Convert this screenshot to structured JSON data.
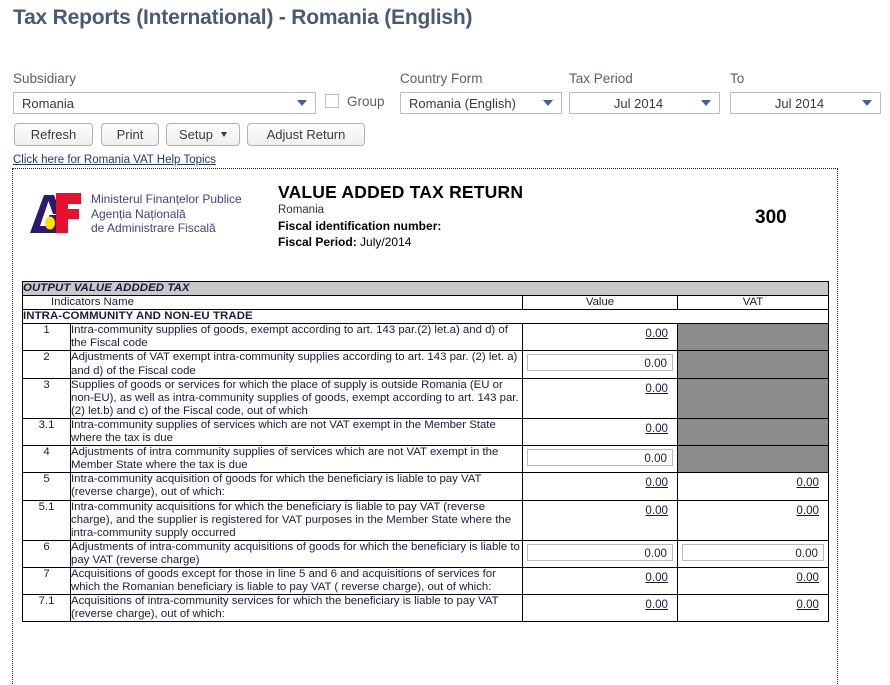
{
  "page_title": "Tax Reports (International) - Romania (English)",
  "filters": {
    "subsidiary": {
      "label": "Subsidiary",
      "value": "Romania"
    },
    "group": {
      "label": "Group",
      "checked": false
    },
    "country_form": {
      "label": "Country Form",
      "value": "Romania (English)"
    },
    "tax_period": {
      "label": "Tax Period",
      "value": "Jul 2014"
    },
    "to": {
      "label": "To",
      "value": "Jul 2014"
    }
  },
  "buttons": {
    "refresh": "Refresh",
    "print": "Print",
    "setup": "Setup",
    "adjust_return": "Adjust Return"
  },
  "help_link": "Click here for Romania VAT Help Topics",
  "report": {
    "agency_lines": "Ministerul Finanțelor Publice\nAgenția Națională\nde Administrare Fiscală",
    "agency_line1": "Ministerul Finanțelor Publice",
    "agency_line2": "Agenția Națională",
    "agency_line3": "de Administrare Fiscală",
    "title": "VALUE ADDED TAX RETURN",
    "country": "Romania",
    "fiscal_id_label": "Fiscal identification number:",
    "fiscal_period_label": "Fiscal Period:",
    "fiscal_period_value": "July/2014",
    "form_number": "300",
    "section_title": "OUTPUT VALUE ADDDED TAX",
    "columns": {
      "indicators": "Indicators Name",
      "value": "Value",
      "vat": "VAT"
    },
    "group_title": "INTRA-COMMUNITY AND NON-EU TRADE",
    "rows": [
      {
        "no": "1",
        "desc": "Intra-community supplies of goods, exempt according to art. 143 par.(2) let.a) and d) of the Fiscal code",
        "value": "0.00",
        "value_type": "link",
        "vat": "",
        "vat_type": "gray"
      },
      {
        "no": "2",
        "desc": "Adjustments of VAT exempt intra-community supplies according to art. 143 par. (2) let. a) and d) of the Fiscal code",
        "value": "0.00",
        "value_type": "input",
        "vat": "",
        "vat_type": "gray"
      },
      {
        "no": "3",
        "desc": "Supplies of goods or services for which the place of supply is outside Romania (EU or non-EU), as well as intra-community supplies of goods, exempt according to art. 143 par.(2) let.b) and c) of the Fiscal code, out of which",
        "value": "0.00",
        "value_type": "link",
        "vat": "",
        "vat_type": "gray"
      },
      {
        "no": "3.1",
        "desc": "Intra-community supplies of services which are not VAT exempt in the Member State where the tax is due",
        "value": "0.00",
        "value_type": "link",
        "vat": "",
        "vat_type": "gray"
      },
      {
        "no": "4",
        "desc": "Adjustments of intra community supplies of services which are not VAT exempt in the Member State where the tax is due",
        "value": "0.00",
        "value_type": "input",
        "vat": "",
        "vat_type": "gray"
      },
      {
        "no": "5",
        "desc": "Intra-community acquisition of goods for which the beneficiary is liable to pay VAT (reverse charge), out of which:",
        "value": "0.00",
        "value_type": "link",
        "vat": "0.00",
        "vat_type": "link"
      },
      {
        "no": "5.1",
        "desc": "Intra-community acquisitions for which the beneficiary is liable to pay VAT (reverse charge), and the supplier is registered for VAT purposes in the Member State where the intra-community supply occurred",
        "value": "0.00",
        "value_type": "link",
        "vat": "0.00",
        "vat_type": "link"
      },
      {
        "no": "6",
        "desc": "Adjustments of intra-community acquisitions of goods for which the beneficiary is liable to pay VAT (reverse charge)",
        "value": "0.00",
        "value_type": "input",
        "vat": "0.00",
        "vat_type": "input"
      },
      {
        "no": "7",
        "desc": "Acquisitions of goods except for those in line 5 and 6 and acquisitions of services for which the Romanian beneficiary is liable to pay VAT ( reverse charge), out of which:",
        "value": "0.00",
        "value_type": "link",
        "vat": "0.00",
        "vat_type": "link"
      },
      {
        "no": "7.1",
        "desc": "Acquisitions of intra-community services for which the beneficiary is liable to pay VAT (reverse charge), out of which:",
        "value": "0.00",
        "value_type": "link",
        "vat": "0.00",
        "vat_type": "link"
      }
    ]
  },
  "colors": {
    "title": "#4a5a73",
    "section_bg": "#c8c8c8",
    "disabled_cell": "#8c8c8c",
    "caret": "#44628d",
    "link": "#243a66"
  }
}
